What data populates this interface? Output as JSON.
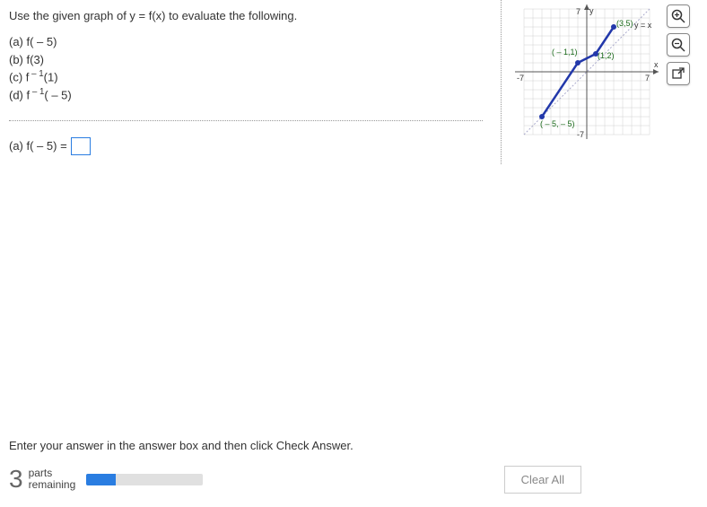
{
  "instruction": "Use the given graph of y = f(x) to evaluate the following.",
  "parts": {
    "a_prefix": "(a) f( – 5)",
    "b_prefix": "(b) f(3)",
    "c_prefix": "(c) f",
    "c_exp": " – 1",
    "c_suffix": "(1)",
    "d_prefix": "(d) f",
    "d_exp": " – 1",
    "d_suffix": "( – 5)"
  },
  "answer": {
    "label_prefix": "(a) f( – 5) =",
    "value": ""
  },
  "footer": {
    "hint": "Enter your answer in the answer box and then click Check Answer.",
    "count": "3",
    "label1": "parts",
    "label2": "remaining",
    "clear": "Clear All"
  },
  "graph": {
    "ylabel": "y",
    "xlabel": "x",
    "ymax": "7",
    "ymin": "-7",
    "xmax": "7",
    "xmin": "-7",
    "eq": "y = x",
    "p1": "(3,5)",
    "p2": "(1,2)",
    "p3": "( – 1,1)",
    "p4": "( – 5, – 5)"
  },
  "chart_data": {
    "type": "line",
    "title": "",
    "xlabel": "x",
    "ylabel": "y",
    "xlim": [
      -7,
      7
    ],
    "ylim": [
      -7,
      7
    ],
    "series": [
      {
        "name": "f(x)",
        "x": [
          -5,
          -1,
          1,
          3
        ],
        "y": [
          -5,
          1,
          2,
          5
        ]
      },
      {
        "name": "y = x",
        "x": [
          -7,
          7
        ],
        "y": [
          -7,
          7
        ]
      }
    ],
    "labeled_points": [
      {
        "x": -5,
        "y": -5,
        "label": "(-5,-5)"
      },
      {
        "x": -1,
        "y": 1,
        "label": "(-1,1)"
      },
      {
        "x": 1,
        "y": 2,
        "label": "(1,2)"
      },
      {
        "x": 3,
        "y": 5,
        "label": "(3,5)"
      }
    ]
  },
  "progress_pct": 25
}
